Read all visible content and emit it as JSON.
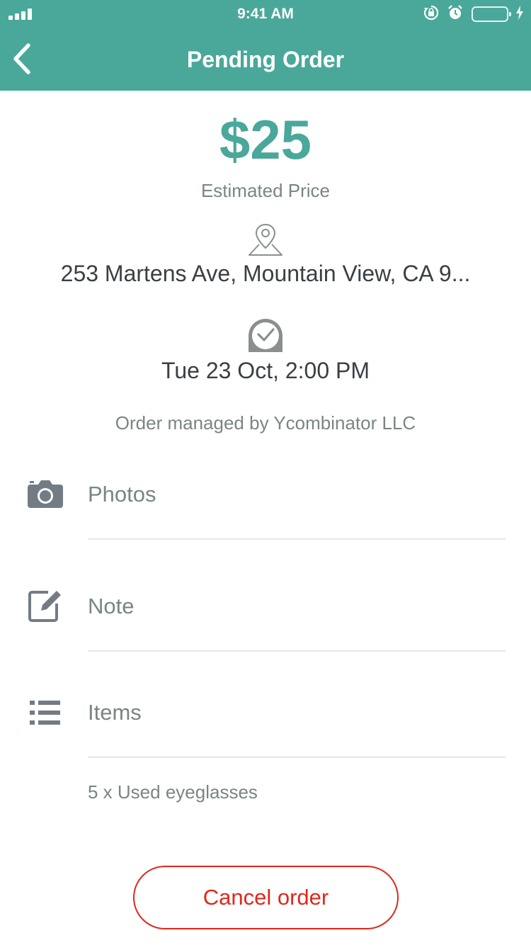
{
  "status_bar": {
    "time": "9:41 AM",
    "icons": [
      "signal-icon",
      "rotation-lock-icon",
      "alarm-icon",
      "battery-icon",
      "charging-icon"
    ]
  },
  "nav": {
    "title": "Pending Order",
    "back_icon": "chevron-left-icon"
  },
  "order": {
    "price": "$25",
    "price_label": "Estimated Price",
    "address_icon": "map-pin-icon",
    "address": "253 Martens Ave, Mountain View, CA 9...",
    "time_icon": "clock-check-icon",
    "datetime": "Tue 23 Oct, 2:00 PM",
    "managed_by": "Order managed by Ycombinator LLC"
  },
  "sections": [
    {
      "icon": "camera-icon",
      "label": "Photos"
    },
    {
      "icon": "edit-note-icon",
      "label": "Note"
    },
    {
      "icon": "list-icon",
      "label": "Items"
    }
  ],
  "items_list": [
    "5 x Used eyeglasses"
  ],
  "actions": {
    "cancel_label": "Cancel order"
  },
  "colors": {
    "brand": "#4aa89a",
    "danger": "#e0281b",
    "muted_text": "#7a8583",
    "battery": "#4cd964"
  }
}
